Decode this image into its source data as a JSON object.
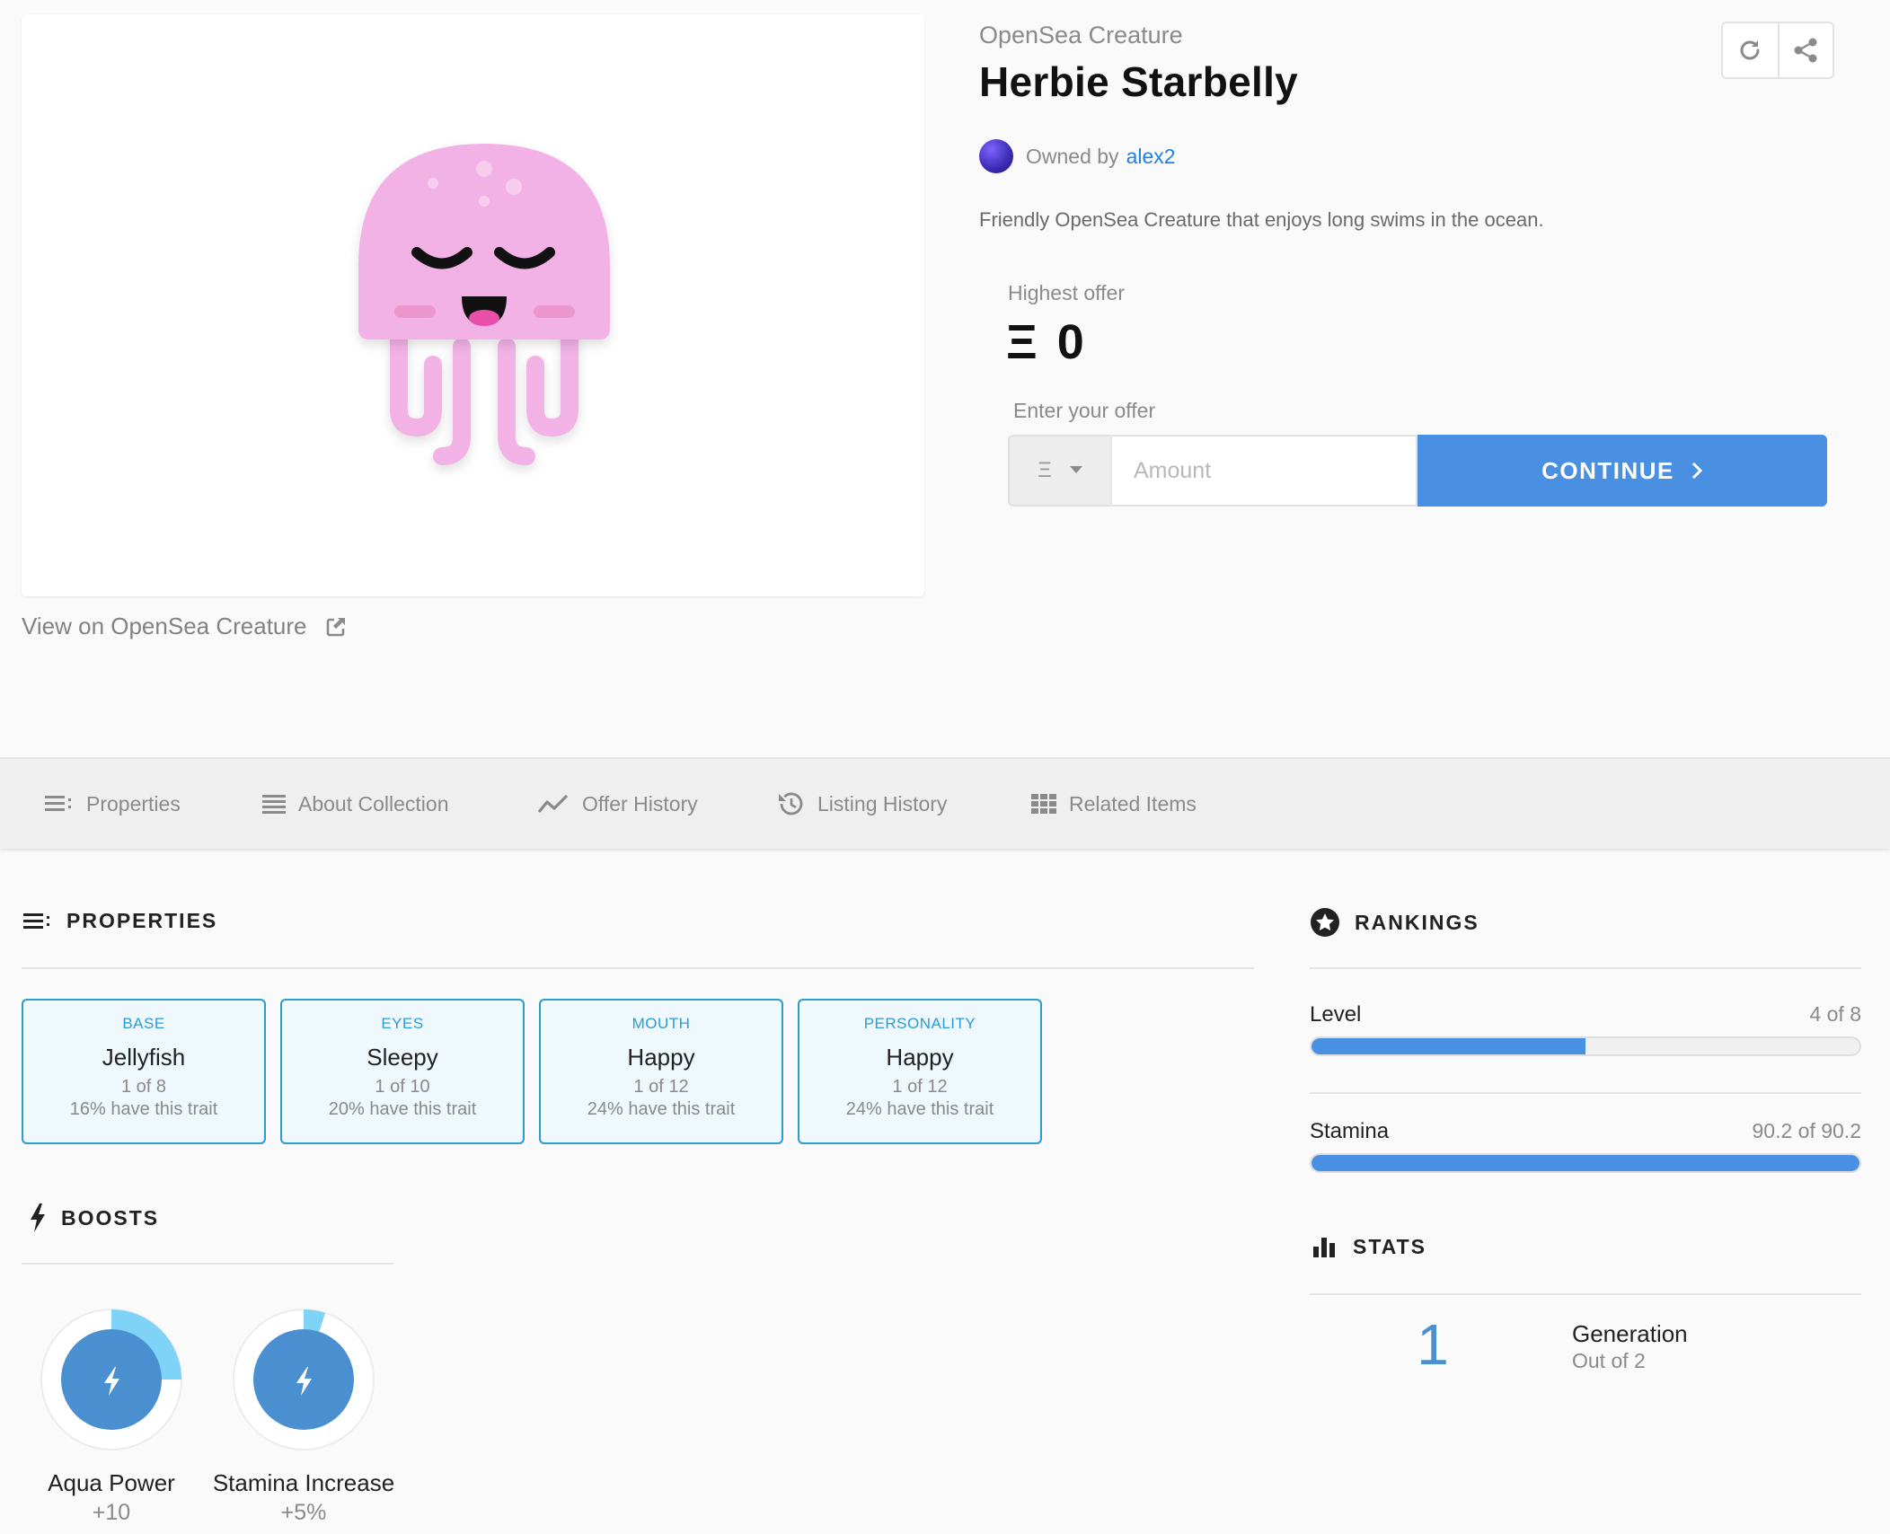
{
  "item": {
    "collection": "OpenSea Creature",
    "title": "Herbie Starbelly",
    "owner_prefix": "Owned by",
    "owner_name": "alex2",
    "description": "Friendly OpenSea Creature that enjoys long swims in the ocean.",
    "view_link": "View on OpenSea Creature"
  },
  "offer": {
    "highest_label": "Highest offer",
    "currency_symbol": "Ξ",
    "highest_value": "0",
    "enter_label": "Enter your offer",
    "amount_placeholder": "Amount",
    "continue_label": "CONTINUE"
  },
  "tabs": [
    {
      "label": "Properties",
      "icon": "list-icon"
    },
    {
      "label": "About Collection",
      "icon": "lines-icon"
    },
    {
      "label": "Offer History",
      "icon": "trend-icon"
    },
    {
      "label": "Listing History",
      "icon": "history-icon"
    },
    {
      "label": "Related Items",
      "icon": "grid-icon"
    }
  ],
  "properties": {
    "heading": "PROPERTIES",
    "traits": [
      {
        "type": "BASE",
        "value": "Jellyfish",
        "count": "1 of 8",
        "pct": "16% have this trait"
      },
      {
        "type": "EYES",
        "value": "Sleepy",
        "count": "1 of 10",
        "pct": "20% have this trait"
      },
      {
        "type": "MOUTH",
        "value": "Happy",
        "count": "1 of 12",
        "pct": "24% have this trait"
      },
      {
        "type": "PERSONALITY",
        "value": "Happy",
        "count": "1 of 12",
        "pct": "24% have this trait"
      }
    ]
  },
  "boosts": {
    "heading": "BOOSTS",
    "items": [
      {
        "name": "Aqua Power",
        "value": "+10",
        "fill": 0.25
      },
      {
        "name": "Stamina Increase",
        "value": "+5%",
        "fill": 0.05
      }
    ]
  },
  "rankings": {
    "heading": "RANKINGS",
    "items": [
      {
        "label": "Level",
        "value": "4 of 8",
        "fraction": 0.5
      },
      {
        "label": "Stamina",
        "value": "90.2 of 90.2",
        "fraction": 1.0
      }
    ]
  },
  "stats": {
    "heading": "STATS",
    "items": [
      {
        "number": "1",
        "label": "Generation",
        "sub": "Out of 2"
      }
    ]
  },
  "colors": {
    "accent": "#4a90e2",
    "link": "#2081e2",
    "trait_border": "#2b9bd6",
    "boost_ring": "#7fd3f7",
    "jelly_pink": "#f2b2e6"
  }
}
